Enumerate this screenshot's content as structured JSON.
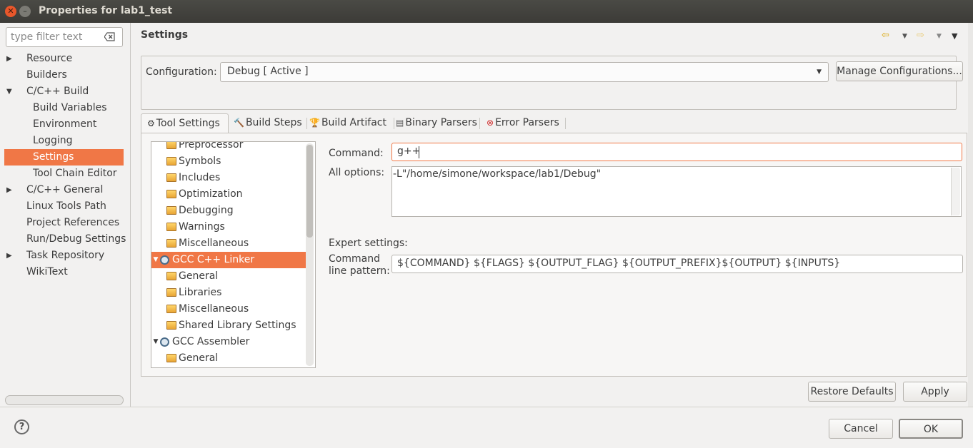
{
  "window": {
    "title": "Properties for lab1_test"
  },
  "filter": {
    "placeholder": "type filter text"
  },
  "nav": {
    "items": [
      {
        "label": "Resource",
        "level": 0,
        "expander": "collapsed"
      },
      {
        "label": "Builders",
        "level": 0,
        "expander": "none"
      },
      {
        "label": "C/C++ Build",
        "level": 0,
        "expander": "expanded"
      },
      {
        "label": "Build Variables",
        "level": 1,
        "expander": "none"
      },
      {
        "label": "Environment",
        "level": 1,
        "expander": "none"
      },
      {
        "label": "Logging",
        "level": 1,
        "expander": "none"
      },
      {
        "label": "Settings",
        "level": 1,
        "expander": "none",
        "selected": true
      },
      {
        "label": "Tool Chain Editor",
        "level": 1,
        "expander": "none"
      },
      {
        "label": "C/C++ General",
        "level": 0,
        "expander": "collapsed"
      },
      {
        "label": "Linux Tools Path",
        "level": 0,
        "expander": "none"
      },
      {
        "label": "Project References",
        "level": 0,
        "expander": "none"
      },
      {
        "label": "Run/Debug Settings",
        "level": 0,
        "expander": "none"
      },
      {
        "label": "Task Repository",
        "level": 0,
        "expander": "collapsed"
      },
      {
        "label": "WikiText",
        "level": 0,
        "expander": "none"
      }
    ]
  },
  "page": {
    "title": "Settings"
  },
  "config": {
    "label": "Configuration:",
    "value": "Debug  [ Active ]",
    "manage_label": "Manage Configurations..."
  },
  "tabs": [
    {
      "label": "Tool Settings",
      "icon": "gear-icon",
      "active": true
    },
    {
      "label": "Build Steps",
      "icon": "hammer-icon"
    },
    {
      "label": "Build Artifact",
      "icon": "trophy-icon"
    },
    {
      "label": "Binary Parsers",
      "icon": "binary-icon"
    },
    {
      "label": "Error Parsers",
      "icon": "error-icon"
    }
  ],
  "tool_tree": [
    {
      "label": "Preprocessor",
      "type": "folder",
      "level": 1
    },
    {
      "label": "Symbols",
      "type": "folder",
      "level": 1
    },
    {
      "label": "Includes",
      "type": "folder",
      "level": 1
    },
    {
      "label": "Optimization",
      "type": "folder",
      "level": 1
    },
    {
      "label": "Debugging",
      "type": "folder",
      "level": 1
    },
    {
      "label": "Warnings",
      "type": "folder",
      "level": 1
    },
    {
      "label": "Miscellaneous",
      "type": "folder",
      "level": 1
    },
    {
      "label": "GCC C++ Linker",
      "type": "tool",
      "level": 0,
      "selected": true
    },
    {
      "label": "General",
      "type": "folder",
      "level": 1
    },
    {
      "label": "Libraries",
      "type": "folder",
      "level": 1
    },
    {
      "label": "Miscellaneous",
      "type": "folder",
      "level": 1
    },
    {
      "label": "Shared Library Settings",
      "type": "folder",
      "level": 1
    },
    {
      "label": "GCC Assembler",
      "type": "tool",
      "level": 0
    },
    {
      "label": "General",
      "type": "folder",
      "level": 1
    }
  ],
  "settings": {
    "command_label": "Command:",
    "command_value": "g++",
    "all_options_label": "All options:",
    "all_options_value": "-L\"/home/simone/workspace/lab1/Debug\"",
    "expert_label": "Expert settings:",
    "cmdline_label_1": "Command",
    "cmdline_label_2": "line pattern:",
    "cmdline_value": "${COMMAND} ${FLAGS} ${OUTPUT_FLAG} ${OUTPUT_PREFIX}${OUTPUT} ${INPUTS}"
  },
  "buttons": {
    "restore": "Restore Defaults",
    "apply": "Apply",
    "cancel": "Cancel",
    "ok": "OK",
    "help": "?"
  },
  "colors": {
    "selection": "#f07746",
    "titlebar": "#3c3b37",
    "background": "#f2f1f0"
  }
}
